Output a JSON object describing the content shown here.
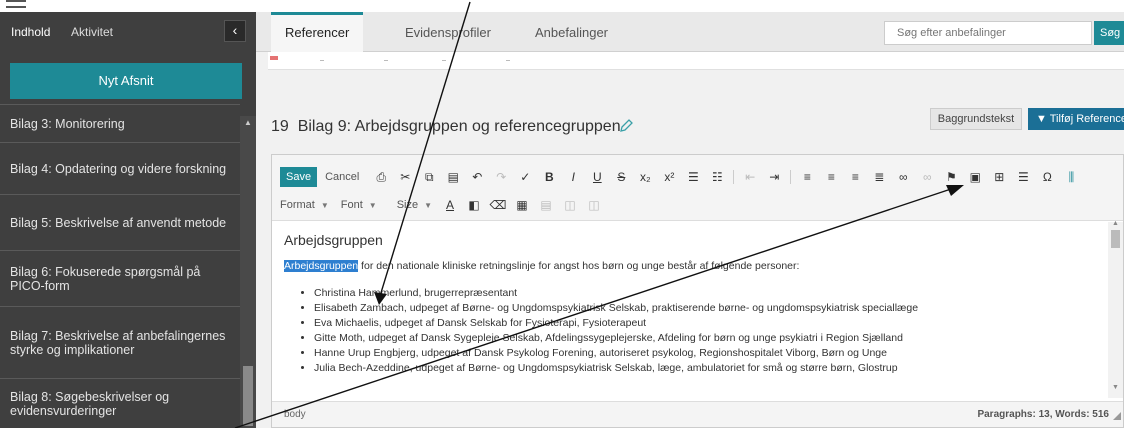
{
  "sidebar": {
    "tabs": [
      "Indhold",
      "Aktivitet"
    ],
    "collapse_glyph": "‹",
    "new_section_label": "Nyt Afsnit",
    "items": [
      "Bilag 3: Monitorering",
      "Bilag 4: Opdatering og videre forskning",
      "Bilag 5: Beskrivelse af anvendt metode",
      "Bilag 6: Fokuserede spørgsmål på PICO-form",
      "Bilag 7: Beskrivelse af anbefalingernes styrke og implikationer",
      "Bilag 8: Søgebeskrivelser og evidensvurderinger"
    ]
  },
  "main": {
    "tabs": [
      "Referencer",
      "Evidensprofiler",
      "Anbefalinger"
    ],
    "search_placeholder": "Søg efter anbefalinger",
    "search_button": "Søg",
    "section_number": "19",
    "section_title": "Bilag 9: Arbejdsgruppen og referencegruppen",
    "background_button": "Baggrundstekst",
    "add_reference_button": "▼ Tilføj Reference"
  },
  "editor": {
    "save": "Save",
    "cancel": "Cancel",
    "format": "Format",
    "font": "Font",
    "size": "Size",
    "heading": "Arbejdsgruppen",
    "intro_highlight": "Arbejdsgruppen",
    "intro_rest": " for den nationale kliniske retningslinje for angst hos børn og unge består af følgende personer:",
    "members": [
      "Christina Hammerlund, brugerrepræsentant",
      "Elisabeth Zambach, udpeget af Børne- og Ungdomspsykiatrisk Selskab, praktiserende børne- og ungdomspsykiatrisk speciallæge",
      "Eva Michaelis, udpeget af Dansk Selskab for Fysioterapi, Fysioterapeut",
      "Gitte Moth, udpeget af Dansk Sygepleje Selskab, Afdelingssygeplejerske, Afdeling for børn og unge psykiatri i Region Sjælland",
      "Hanne Urup Engbjerg, udpeget af Dansk Psykolog Forening, autoriseret psykolog, Regionshospitalet Viborg, Børn og Unge",
      "Julia Bech-Azeddine, udpeget af Børne- og Ungdomspsykiatrisk Selskab, læge, ambulatoriet for små og større børn, Glostrup"
    ],
    "status_path": "body",
    "status_count": "Paragraphs: 13, Words: 516"
  },
  "colors": {
    "accent": "#1e8a96",
    "sidebar_bg": "#3f3f3f",
    "add_ref": "#1b6f96",
    "highlight": "#2e7fd0"
  }
}
